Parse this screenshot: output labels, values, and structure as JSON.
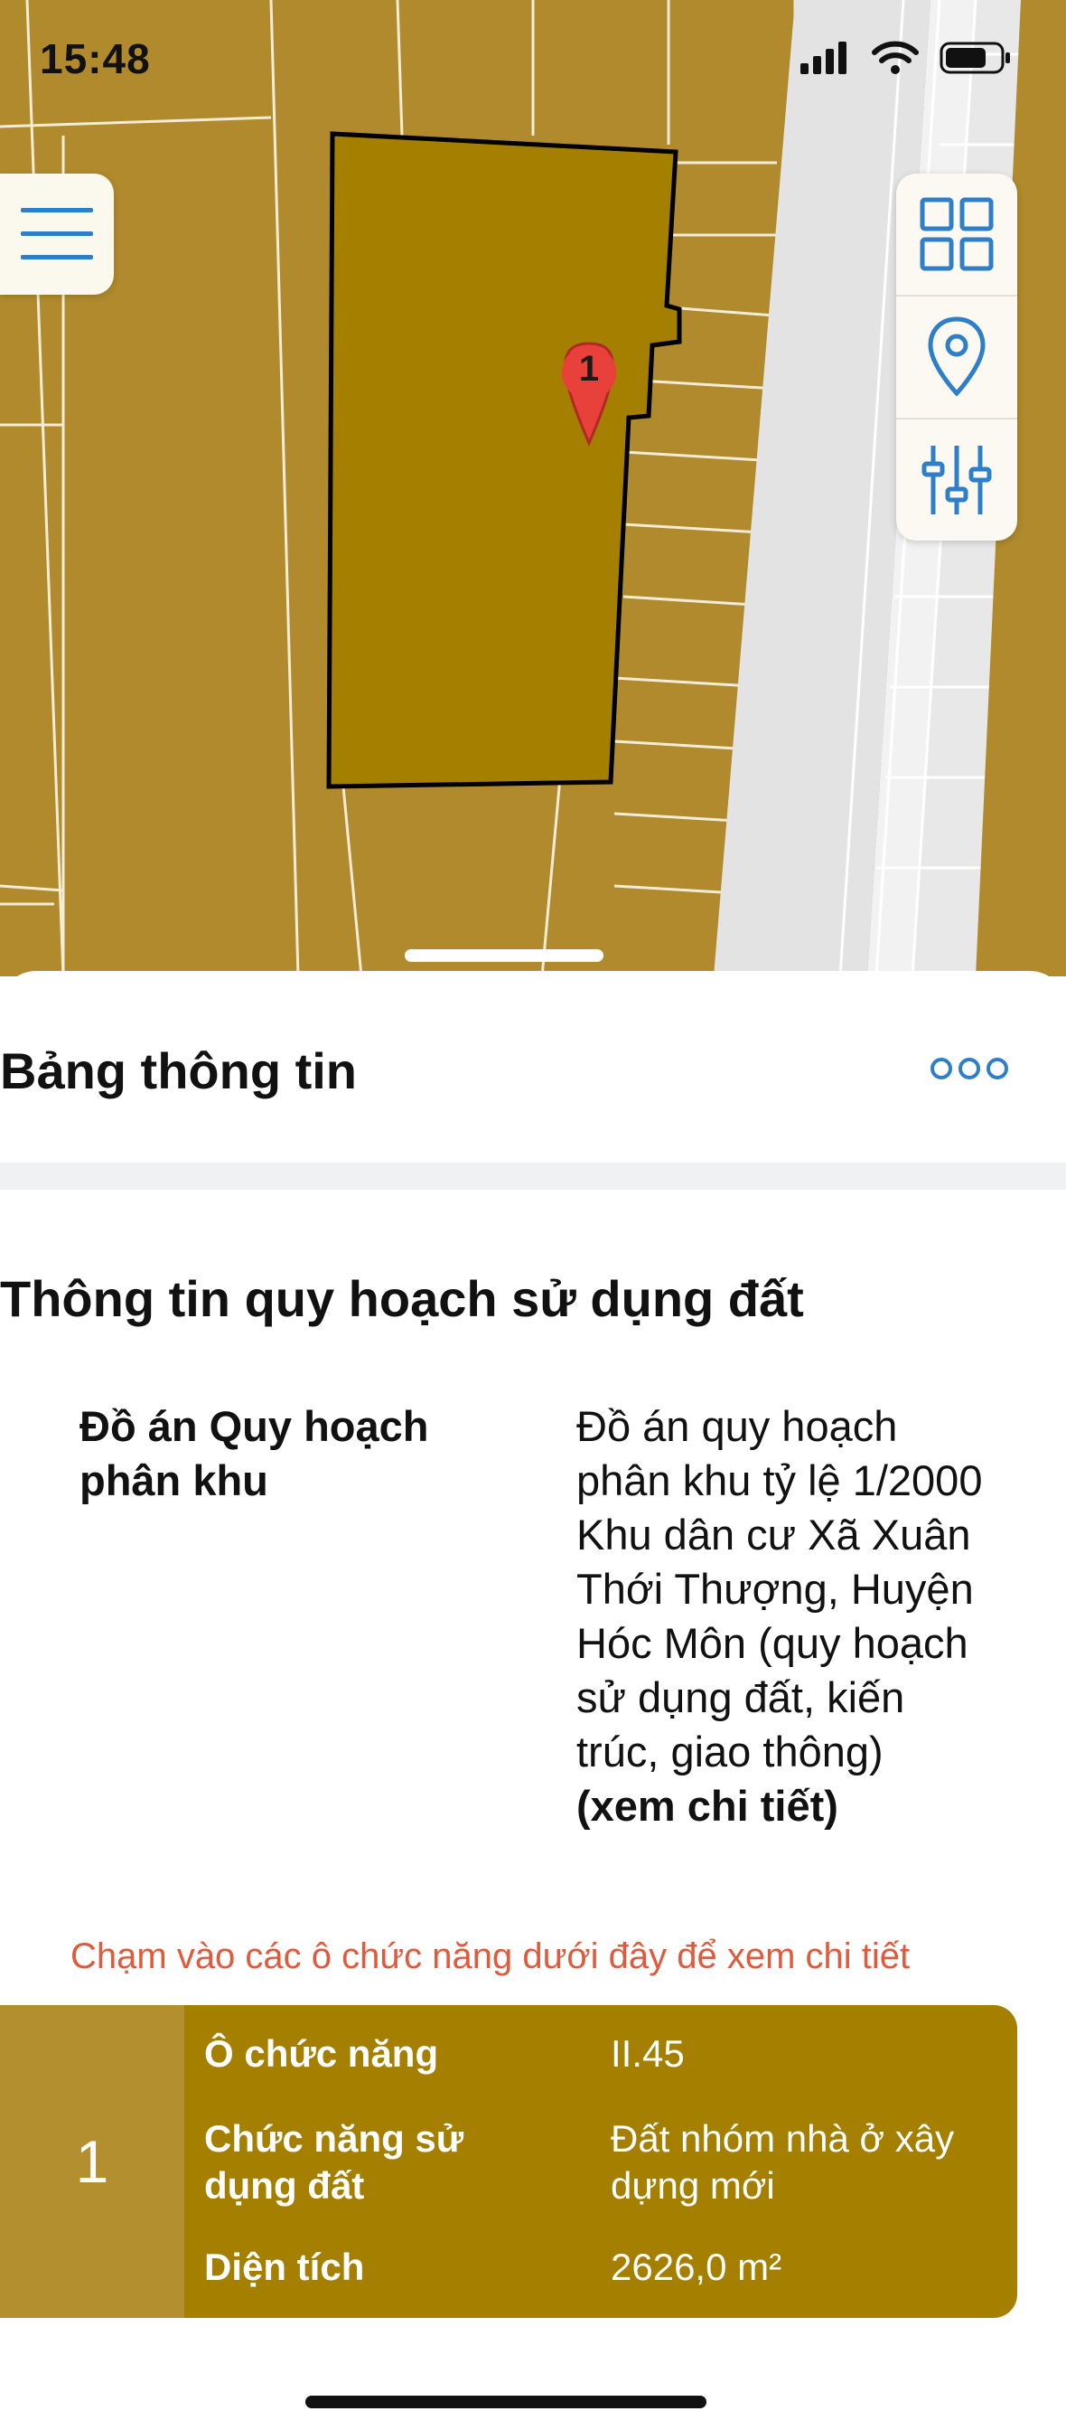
{
  "status_bar": {
    "time": "15:48"
  },
  "map": {
    "parcel_marker_label": "1",
    "colors": {
      "land": "#b08a2c",
      "parcel": "#a57f00",
      "road": "#e3e3e3",
      "marker": "#e8403a"
    },
    "buttons": {
      "menu_icon": "hamburger-icon",
      "layers_icon": "grid-icon",
      "location_icon": "location-pin-icon",
      "filter_icon": "sliders-icon"
    }
  },
  "sheet": {
    "title": "Bảng thông tin",
    "more_icon": "more-dots-icon",
    "section_title": "Thông tin quy hoạch sử dụng đất",
    "plan": {
      "label": "Đồ án Quy hoạch phân khu",
      "value": "Đồ án quy hoạch phân khu tỷ lệ 1/2000 Khu dân cư Xã Xuân Thới Thượng, Huyện Hóc Môn (quy hoạch sử dụng đất, kiến trúc, giao thông)",
      "detail_link": "(xem chi tiết)"
    },
    "hint": "Chạm vào các ô chức năng dưới đây để xem chi tiết",
    "function_card": {
      "index": "1",
      "rows": [
        {
          "label": "Ô chức năng",
          "value": "II.45"
        },
        {
          "label": "Chức năng sử dụng đất",
          "value": "Đất nhóm nhà ở xây dựng mới"
        },
        {
          "label": "Diện tích",
          "value": "2626,0 m²"
        }
      ],
      "colors": {
        "card": "#a57f00",
        "index_cell": "#b38f2f"
      }
    }
  }
}
